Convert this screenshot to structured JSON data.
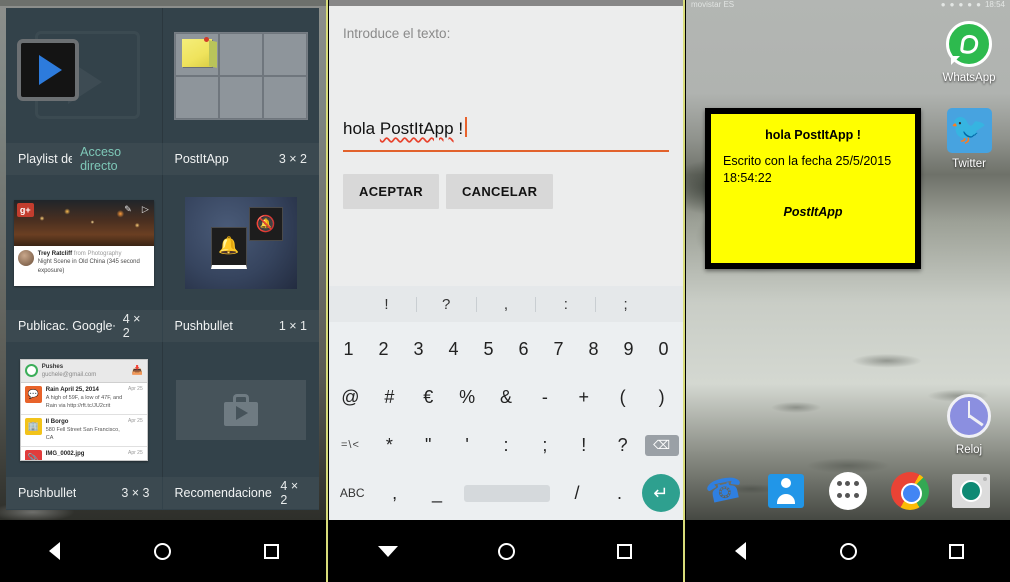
{
  "panel_widget_picker": {
    "status_bar": {
      "visible": true
    },
    "widgets": [
      {
        "name": "Playlist de..",
        "meta": "Acceso directo",
        "meta_accent": true,
        "art": "playlist-shortcut"
      },
      {
        "name": "PostItApp",
        "meta": "3 × 2",
        "meta_accent": false,
        "art": "postit-grid"
      },
      {
        "name": "Publicac. Google+",
        "meta": "4 × 2",
        "meta_accent": false,
        "art": "google-plus-post"
      },
      {
        "name": "Pushbullet",
        "meta": "1 × 1",
        "meta_accent": false,
        "art": "pushbullet-small"
      },
      {
        "name": "Pushbullet",
        "meta": "3 × 3",
        "meta_accent": false,
        "art": "pushbullet-large"
      },
      {
        "name": "Recomendaciones",
        "meta": "4 × 2",
        "meta_accent": false,
        "art": "play-recommendations"
      }
    ],
    "gplus_card": {
      "badge": "g+",
      "author": "Trey Ratcliff",
      "author_suffix": "from Photography",
      "caption": "Night Scene in Old China  (345 second exposure)"
    },
    "pushbullet_card": {
      "title": "Pushes",
      "email": "guchele@gmail.com",
      "rows": [
        {
          "title": "Rain April 25, 2014",
          "sub": "A high of 59F, a low of 47F, and Rain via http://rft.tc/JU2crit",
          "date": "Apr 25",
          "color": "#e8632a"
        },
        {
          "title": "Il Borgo",
          "sub": "580 Fell Street\nSan Francisco, CA",
          "date": "Apr 25",
          "color": "#f2c31a"
        },
        {
          "title": "IMG_0002.jpg",
          "sub": "",
          "date": "Apr 25",
          "color": "#e13c3c"
        }
      ]
    },
    "navbar": {
      "back": "back-triangle",
      "home": "home-circle",
      "recents": "recents-square"
    }
  },
  "panel_keyboard": {
    "dialog": {
      "prompt": "Introduce el texto:",
      "input_value_plain": "hola ",
      "input_value_misspelled": "PostItApp",
      "input_value_tail": " !",
      "input_placeholder": "Introduce el texto",
      "accept_label": "ACEPTAR",
      "cancel_label": "CANCELAR"
    },
    "keyboard": {
      "suggestions": [
        "!",
        "?",
        ",",
        ":",
        ";"
      ],
      "row_numbers": [
        "1",
        "2",
        "3",
        "4",
        "5",
        "6",
        "7",
        "8",
        "9",
        "0"
      ],
      "row_symbols": [
        "@",
        "#",
        "€",
        "%",
        "&",
        "-",
        "+",
        "(",
        ")"
      ],
      "row_symbols2": [
        "=\\<",
        "*",
        "\"",
        "'",
        ":",
        ";",
        "!",
        "?"
      ],
      "delete_key": "⌫",
      "row_bottom": {
        "abc": "ABC",
        "comma": ",",
        "underscore": "_",
        "space": "",
        "slash": "/",
        "period": ".",
        "enter": "↵"
      }
    },
    "navbar": {
      "back": "hide-keyboard-triangle",
      "home": "home-circle",
      "recents": "recents-square"
    }
  },
  "panel_home": {
    "status_bar": {
      "left": "movistar ES",
      "right_icons": [
        "bluetooth-icon",
        "location-icon",
        "download-icon",
        "signal-icon",
        "battery-icon"
      ],
      "clock": "18:54"
    },
    "note_widget": {
      "title": "hola PostItApp !",
      "body": "Escrito con la fecha 25/5/2015 18:54:22",
      "signature": "PostItApp",
      "background_color": "#ffff00",
      "border_color": "#000000"
    },
    "apps": [
      {
        "label": "WhatsApp",
        "icon": "whatsapp-icon"
      },
      {
        "label": "Twitter",
        "icon": "twitter-icon"
      },
      {
        "label": "Reloj",
        "icon": "clock-icon"
      }
    ],
    "dock": [
      {
        "icon": "phone-icon"
      },
      {
        "icon": "contacts-icon"
      },
      {
        "icon": "app-drawer-icon"
      },
      {
        "icon": "chrome-icon"
      },
      {
        "icon": "camera-icon"
      }
    ],
    "navbar": {
      "back": "back-triangle",
      "home": "home-circle",
      "recents": "recents-square"
    }
  }
}
